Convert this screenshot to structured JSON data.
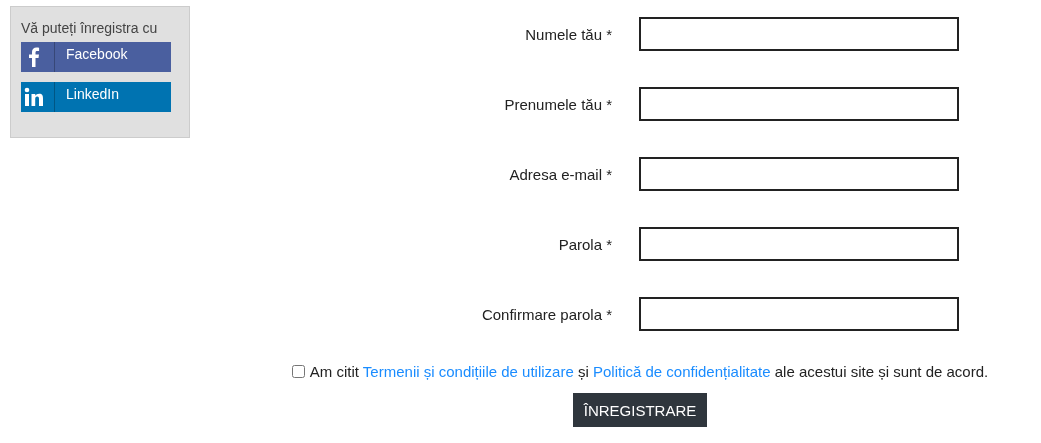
{
  "social_login": {
    "title": "Vă puteți înregistra cu",
    "buttons": [
      {
        "kind": "facebook",
        "label": "Facebook",
        "color": "#4a5f9f"
      },
      {
        "kind": "linkedin",
        "label": "LinkedIn",
        "color": "#0073b1"
      }
    ]
  },
  "fields": [
    {
      "label": "Numele tău *"
    },
    {
      "label": "Prenumele tău *"
    },
    {
      "label": "Adresa e-mail *"
    },
    {
      "label": "Parola *"
    },
    {
      "label": "Confirmare parola *"
    }
  ],
  "agreement": {
    "checked": false,
    "parts": [
      {
        "kind": "text",
        "text": "Am citit "
      },
      {
        "kind": "link",
        "text": "Termenii și condițiile de utilizare"
      },
      {
        "kind": "text",
        "text": " și "
      },
      {
        "kind": "link",
        "text": "Politică de confidențialitate"
      },
      {
        "kind": "text",
        "text": " ale acestui site și sunt de acord."
      }
    ]
  },
  "submit": {
    "label": "ÎNREGISTRARE"
  }
}
